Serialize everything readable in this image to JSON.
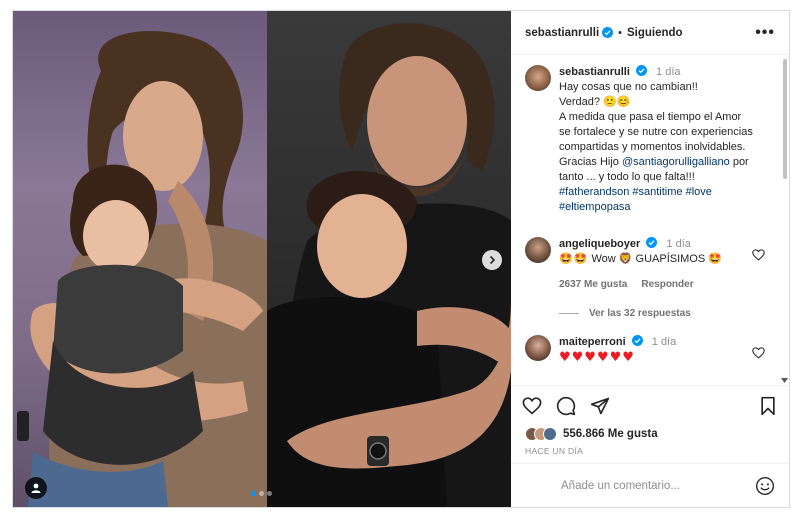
{
  "post": {
    "author": "sebastianrulli",
    "follow_state": "Siguiendo",
    "separator": "•",
    "more_label": "•••",
    "caption": {
      "time": "1 día",
      "line1": "Hay cosas que no cambian!!",
      "line2_text": "Verdad? ",
      "line2_emojis": "🙂😊",
      "line3": "A medida que pasa el tiempo el Amor",
      "line4": "se fortalece y se nutre con experiencias",
      "line5": "compartidas y momentos inolvidables.",
      "line6_pre": "Gracias Hijo ",
      "line6_mention": "@santiagorulligalliano",
      "line6_post": " por",
      "line7": "tanto ... y todo lo que falta!!!",
      "hashtags_line1": "#fatherandson #santitime #love",
      "hashtags_line2": "#eltiempopasa"
    },
    "comments": [
      {
        "user": "angeliqueboyer",
        "time": "1 día",
        "emoji_prefix": "🤩🤩",
        "text": " Wow 🦁 GUAPÍSIMOS ",
        "emoji_suffix": "🤩",
        "likes": "2637 Me gusta",
        "reply_label": "Responder",
        "view_replies": "Ver las 32 respuestas"
      },
      {
        "user": "maiteperroni",
        "time": "1 día",
        "text": "♥♥♥♥♥♥"
      }
    ],
    "likes_count": "556.866 Me gusta",
    "posted_ago": "HACE UN DÍA",
    "add_comment_placeholder": "Añade un comentario..."
  },
  "colors": {
    "verified": "#0095f6",
    "hearts": "#ed1c24",
    "active_dot": "#0095f6"
  },
  "icons": [
    "verified-icon",
    "more-options-icon",
    "heart-icon",
    "comment-icon",
    "share-icon",
    "save-icon",
    "emoji-icon",
    "user-tag-icon",
    "chevron-right-icon"
  ]
}
